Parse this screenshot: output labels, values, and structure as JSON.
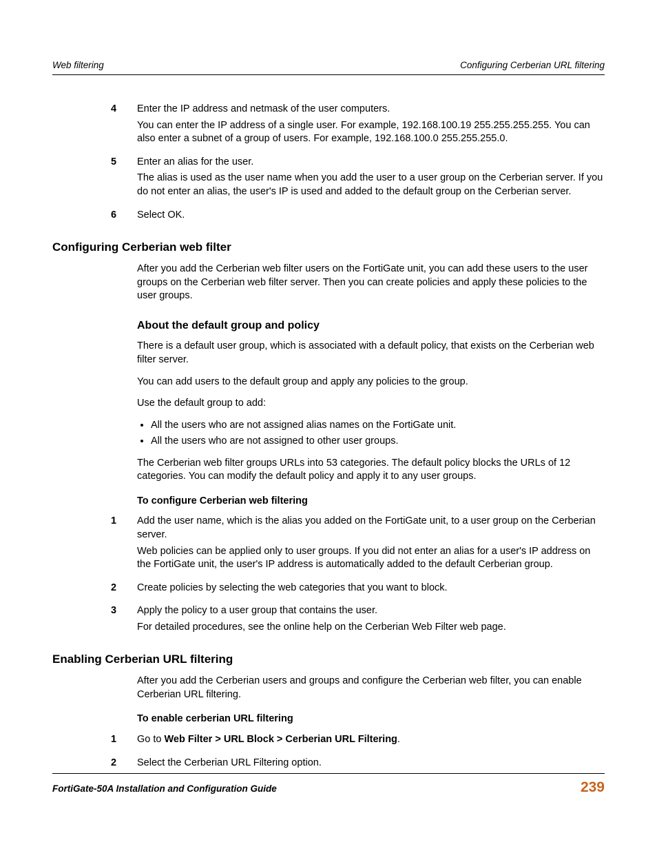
{
  "header": {
    "left": "Web filtering",
    "right": "Configuring Cerberian URL filtering"
  },
  "footer": {
    "left": "FortiGate-50A Installation and Configuration Guide",
    "right": "239"
  },
  "steps_top": [
    {
      "num": "4",
      "line1": "Enter the IP address and netmask of the user computers.",
      "line2": "You can enter the IP address of a single user. For example, 192.168.100.19 255.255.255.255. You can also enter a subnet of a group of users. For example, 192.168.100.0 255.255.255.0."
    },
    {
      "num": "5",
      "line1": "Enter an alias for the user.",
      "line2": "The alias is used as the user name when you add the user to a user group on the Cerberian server. If you do not enter an alias, the user's IP is used and added to the default group on the Cerberian server."
    },
    {
      "num": "6",
      "line1": "Select OK.",
      "line2": ""
    }
  ],
  "section1": {
    "title": "Configuring Cerberian web filter",
    "p1": "After you add the Cerberian web filter users on the FortiGate unit, you can add these users to the user groups on the Cerberian web filter server. Then you can create policies and apply these policies to the user groups."
  },
  "subsection1": {
    "title": "About the default group and policy",
    "p1": "There is a default user group, which is associated with a default policy, that exists on the Cerberian web filter server.",
    "p2": "You can add users to the default group and apply any policies to the group.",
    "p3": "Use the default group to add:",
    "bullets": [
      "All the users who are not assigned alias names on the FortiGate unit.",
      "All the users who are not assigned to other user groups."
    ],
    "p4": "The Cerberian web filter groups URLs into 53 categories. The default policy blocks the URLs of 12 categories. You can modify the default policy and apply it to any user groups."
  },
  "task1": {
    "title": "To configure Cerberian web filtering",
    "steps": [
      {
        "num": "1",
        "line1": "Add the user name, which is the alias you added on the FortiGate unit, to a user group on the Cerberian server.",
        "line2": "Web policies can be applied only to user groups. If you did not enter an alias for a user's IP address on the FortiGate unit, the user's IP address is automatically added to the default Cerberian group."
      },
      {
        "num": "2",
        "line1": "Create policies by selecting the web categories that you want to block.",
        "line2": ""
      },
      {
        "num": "3",
        "line1": "Apply the policy to a user group that contains the user.",
        "line2": "For detailed procedures, see the online help on the Cerberian Web Filter web page."
      }
    ]
  },
  "section2": {
    "title": "Enabling Cerberian URL filtering",
    "p1": "After you add the Cerberian users and groups and configure the Cerberian web filter, you can enable Cerberian URL filtering."
  },
  "task2": {
    "title": "To enable cerberian URL filtering",
    "steps": [
      {
        "num": "1",
        "prefix": "Go to ",
        "bold": "Web Filter > URL Block > Cerberian URL Filtering",
        "suffix": "."
      },
      {
        "num": "2",
        "line1": "Select the Cerberian URL Filtering option."
      }
    ]
  }
}
